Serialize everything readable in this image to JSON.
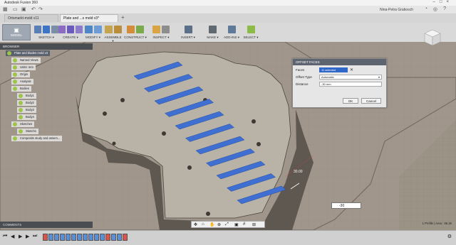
{
  "window": {
    "title": "Autodesk Fusion 360",
    "user": "Nina-Petra Grabosch"
  },
  "tabs": [
    {
      "label": "Ortsmarkt-mold v11",
      "active": false
    },
    {
      "label": "Plate and ...s mold v3*",
      "active": true
    }
  ],
  "ribbon": {
    "workspace": "MODEL",
    "groups": [
      {
        "label": "SKETCH",
        "colors": [
          "#5a7fb5",
          "#3e74c4",
          "#7a8ea8"
        ]
      },
      {
        "label": "CREATE",
        "colors": [
          "#8c6bc2",
          "#6a5bbd",
          "#8d7cc9"
        ]
      },
      {
        "label": "MODIFY",
        "colors": [
          "#4f86c6",
          "#6d9bd3"
        ]
      },
      {
        "label": "ASSEMBLE",
        "colors": [
          "#c6a34f",
          "#b98d3a"
        ]
      },
      {
        "label": "CONSTRUCT",
        "colors": [
          "#d48b3a",
          "#7aaa4a"
        ]
      },
      {
        "label": "INSPECT",
        "colors": [
          "#d9a441",
          "#8d8d8d"
        ]
      },
      {
        "label": "INSERT",
        "colors": [
          "#5b6f88"
        ]
      },
      {
        "label": "MAKE",
        "colors": [
          "#606870"
        ]
      },
      {
        "label": "ADD-INS",
        "colors": [
          "#5f7a98"
        ]
      },
      {
        "label": "SELECT",
        "colors": [
          "#8dbb48"
        ]
      }
    ]
  },
  "browser": {
    "header": "BROWSER",
    "items": [
      {
        "label": "Plate and blades mold v3",
        "depth": 0
      },
      {
        "label": "Named Views",
        "depth": 1
      },
      {
        "label": "Units: mm",
        "depth": 1
      },
      {
        "label": "Origin",
        "depth": 1
      },
      {
        "label": "Analysis",
        "depth": 1
      },
      {
        "label": "Bodies",
        "depth": 1
      },
      {
        "label": "Body1",
        "depth": 2
      },
      {
        "label": "Body2",
        "depth": 2
      },
      {
        "label": "Body3",
        "depth": 2
      },
      {
        "label": "Body4",
        "depth": 2
      },
      {
        "label": "Sketches",
        "depth": 1
      },
      {
        "label": "Sketch1",
        "depth": 2
      },
      {
        "label": "Composite study and assem...",
        "depth": 1
      }
    ]
  },
  "dialog": {
    "title": "OFFSET FACES",
    "faces_label": "Faces",
    "faces_value": "11 selected",
    "offset_type_label": "Offset Type",
    "offset_type_value": "Automatic",
    "distance_label": "Distance",
    "distance_value": "-30 mm",
    "ok": "OK",
    "cancel": "Cancel"
  },
  "viewport": {
    "dimension_label": "30.00",
    "value_input": "-30"
  },
  "comments": {
    "header": "COMMENTS"
  },
  "status": {
    "text": "1 Profile | Area : 86.26"
  }
}
